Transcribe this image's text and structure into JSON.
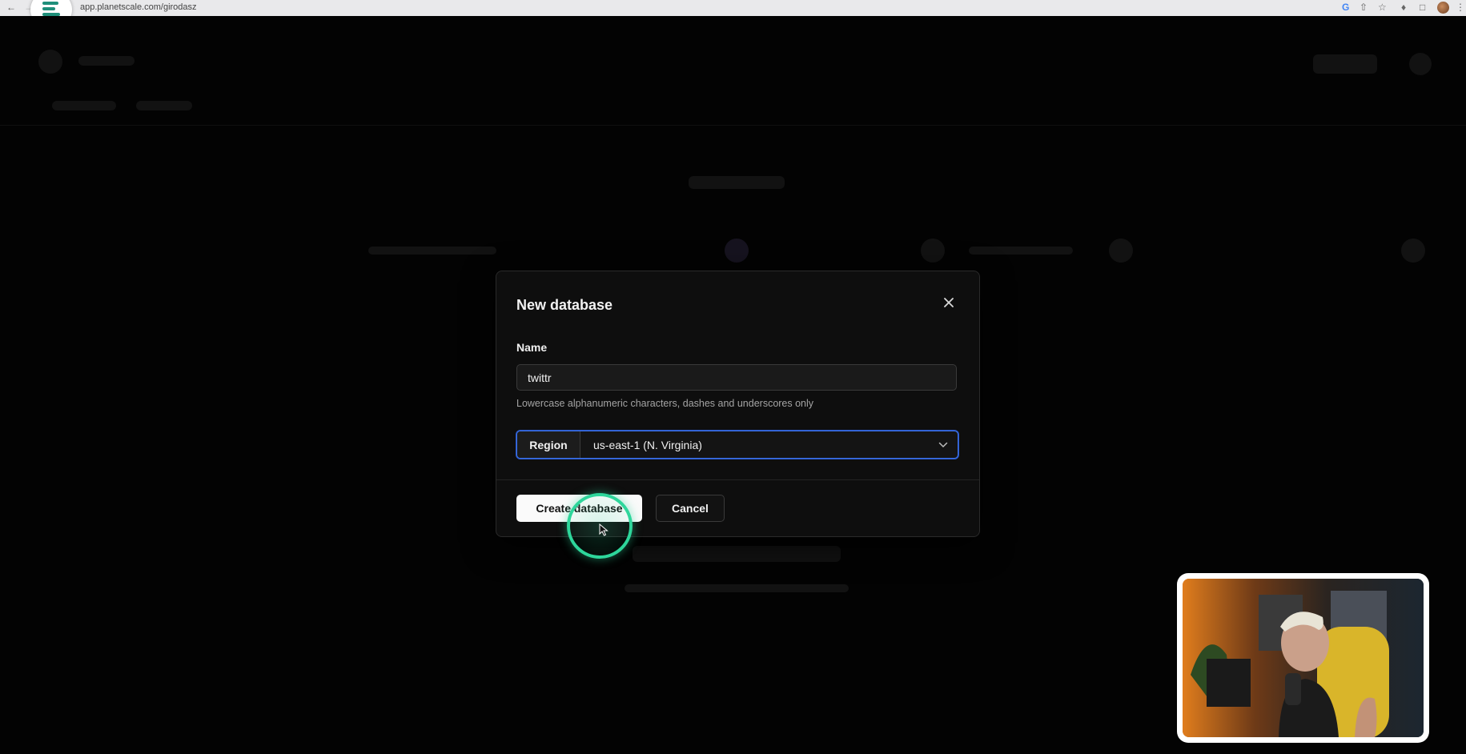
{
  "browser": {
    "url": "app.planetscale.com/girodasz"
  },
  "modal": {
    "title": "New database",
    "name_label": "Name",
    "name_value": "twittr",
    "name_help": "Lowercase alphanumeric characters, dashes and underscores only",
    "region_label": "Region",
    "region_value": "us-east-1 (N. Virginia)",
    "create_label": "Create database",
    "cancel_label": "Cancel"
  },
  "colors": {
    "focus_ring": "#3b6fe0",
    "click_highlight": "#2ed69b",
    "brand": "#1f8f7a"
  },
  "icons": {
    "close": "close-icon",
    "chevron": "chevron-down-icon",
    "cursor": "mouse-cursor-icon"
  }
}
